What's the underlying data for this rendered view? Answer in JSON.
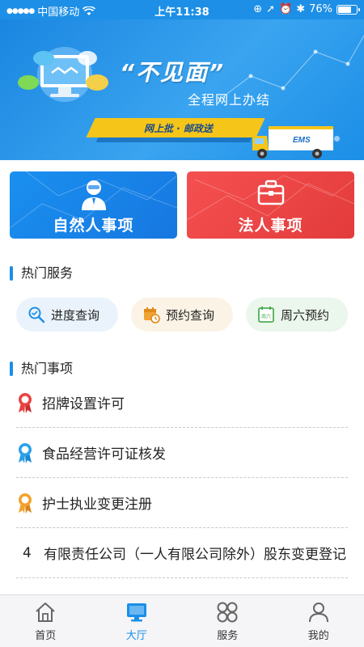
{
  "status_bar": {
    "carrier": "中国移动",
    "time": "上午11:38",
    "battery": "76%",
    "battery_level": 0.76
  },
  "banner": {
    "headline": "“不见面”",
    "subline": "全程网上办结",
    "ribbon": "网上批 · 邮政送",
    "truck_label": "EMS",
    "carousel_pages": 2,
    "active_page": 1
  },
  "categories": [
    {
      "label": "自然人事项",
      "color": "#1a86ea",
      "icon": "person-icon"
    },
    {
      "label": "法人事项",
      "color": "#e94242",
      "icon": "briefcase-icon"
    }
  ],
  "hot_services": {
    "title": "热门服务",
    "items": [
      {
        "label": "进度查询",
        "icon": "progress-search-icon"
      },
      {
        "label": "预约查询",
        "icon": "calendar-clock-icon"
      },
      {
        "label": "周六预约",
        "icon": "saturday-calendar-icon",
        "icon_text": "周六"
      }
    ]
  },
  "hot_items": {
    "title": "热门事项",
    "items": [
      {
        "rank": "",
        "label": "招牌设置许可",
        "badge": "red-award-icon"
      },
      {
        "rank": "",
        "label": "食品经营许可证核发",
        "badge": "blue-award-icon"
      },
      {
        "rank": "",
        "label": "护士执业变更注册",
        "badge": "orange-award-icon"
      },
      {
        "rank": "4",
        "label": "有限责任公司（一人有限公司除外）股东变更登记",
        "badge": ""
      }
    ]
  },
  "tab_bar": {
    "tabs": [
      {
        "label": "首页",
        "icon": "home-icon",
        "active": false
      },
      {
        "label": "大厅",
        "icon": "monitor-icon",
        "active": true
      },
      {
        "label": "服务",
        "icon": "grid-icon",
        "active": false
      },
      {
        "label": "我的",
        "icon": "user-icon",
        "active": false
      }
    ]
  },
  "colors": {
    "accent": "#1a8fe8",
    "blue_card": "#1a86ea",
    "red_card": "#e94242"
  }
}
